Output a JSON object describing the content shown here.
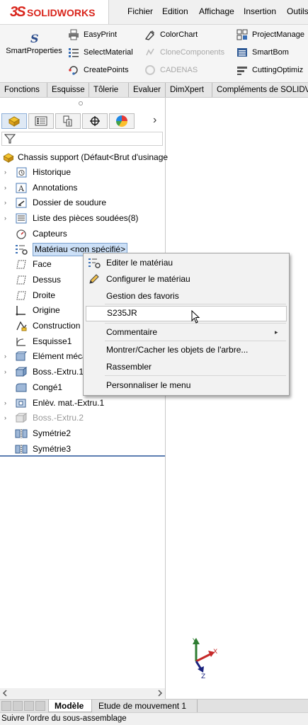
{
  "app": {
    "logo_prefix": "3S",
    "logo_name": "SOLIDWORKS"
  },
  "menu": [
    "Fichier",
    "Edition",
    "Affichage",
    "Insertion",
    "Outils"
  ],
  "toolbar": {
    "smart_properties": "SmartProperties",
    "easyprint": "EasyPrint",
    "select_material": "SelectMaterial",
    "create_points": "CreatePoints",
    "colorchart": "ColorChart",
    "clone_components": "CloneComponents",
    "cadenas": "CADENAS",
    "project_manager": "ProjectManage",
    "smartbom": "SmartBom",
    "cutting_optim": "CuttingOptimiz"
  },
  "command_tabs": [
    "Fonctions",
    "Esquisse",
    "Tôlerie",
    "Evaluer",
    "DimXpert",
    "Compléments de SOLIDV"
  ],
  "panel_tabs_more": "›",
  "tree": {
    "root": "Chassis support  (Défaut<Brut d'usinage",
    "items": [
      {
        "label": "Historique",
        "arrow": "›"
      },
      {
        "label": "Annotations",
        "arrow": "›"
      },
      {
        "label": "Dossier de soudure",
        "arrow": "›"
      },
      {
        "label": "Liste des pièces soudées(8)",
        "arrow": "›"
      },
      {
        "label": "Capteurs",
        "arrow": ""
      },
      {
        "label": "Matériau <non spécifié>",
        "arrow": ""
      },
      {
        "label": "Face",
        "arrow": ""
      },
      {
        "label": "Dessus",
        "arrow": ""
      },
      {
        "label": "Droite",
        "arrow": ""
      },
      {
        "label": "Origine",
        "arrow": ""
      },
      {
        "label": "Construction",
        "arrow": ""
      },
      {
        "label": "Esquisse1",
        "arrow": ""
      },
      {
        "label": "Elément méca",
        "arrow": "›"
      },
      {
        "label": "Boss.-Extru.1",
        "arrow": "›"
      },
      {
        "label": "Congé1",
        "arrow": ""
      },
      {
        "label": "Enlèv. mat.-Extru.1",
        "arrow": "›"
      },
      {
        "label": "Boss.-Extru.2",
        "arrow": "›"
      },
      {
        "label": "Symétrie2",
        "arrow": ""
      },
      {
        "label": "Symétrie3",
        "arrow": ""
      }
    ]
  },
  "context_menu": {
    "edit_material": "Editer le matériau",
    "configure_material": "Configurer le matériau",
    "favorites": "Gestion des favoris",
    "s235jr": "S235JR",
    "comment": "Commentaire",
    "show_hide": "Montrer/Cacher les objets de l'arbre...",
    "collapse": "Rassembler",
    "customize": "Personnaliser le menu",
    "submenu_arrow": "▸"
  },
  "triad": {
    "x": "X",
    "y": "Y",
    "z": "Z"
  },
  "bottom_tabs": [
    "Modèle",
    "Etude de mouvement 1"
  ],
  "status": "Suivre l'ordre du sous-assemblage"
}
